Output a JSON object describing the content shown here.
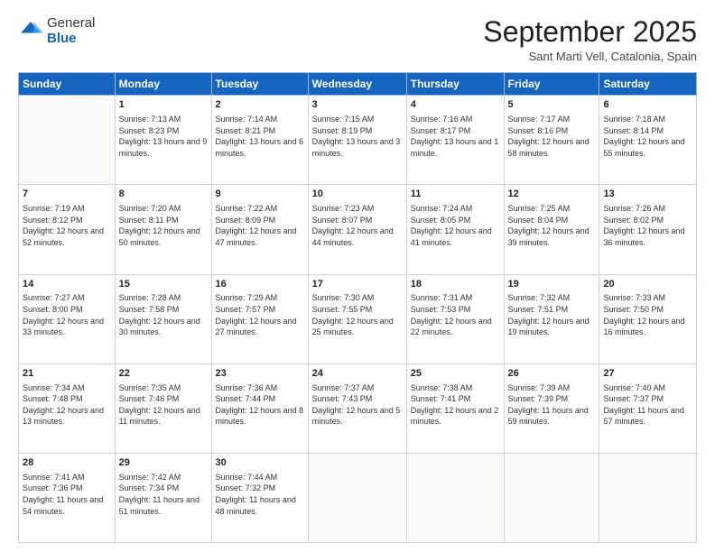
{
  "logo": {
    "general": "General",
    "blue": "Blue"
  },
  "header": {
    "title": "September 2025",
    "location": "Sant Marti Vell, Catalonia, Spain"
  },
  "weekdays": [
    "Sunday",
    "Monday",
    "Tuesday",
    "Wednesday",
    "Thursday",
    "Friday",
    "Saturday"
  ],
  "weeks": [
    [
      {
        "day": "",
        "sunrise": "",
        "sunset": "",
        "daylight": ""
      },
      {
        "day": "1",
        "sunrise": "Sunrise: 7:13 AM",
        "sunset": "Sunset: 8:23 PM",
        "daylight": "Daylight: 13 hours and 9 minutes."
      },
      {
        "day": "2",
        "sunrise": "Sunrise: 7:14 AM",
        "sunset": "Sunset: 8:21 PM",
        "daylight": "Daylight: 13 hours and 6 minutes."
      },
      {
        "day": "3",
        "sunrise": "Sunrise: 7:15 AM",
        "sunset": "Sunset: 8:19 PM",
        "daylight": "Daylight: 13 hours and 3 minutes."
      },
      {
        "day": "4",
        "sunrise": "Sunrise: 7:16 AM",
        "sunset": "Sunset: 8:17 PM",
        "daylight": "Daylight: 13 hours and 1 minute."
      },
      {
        "day": "5",
        "sunrise": "Sunrise: 7:17 AM",
        "sunset": "Sunset: 8:16 PM",
        "daylight": "Daylight: 12 hours and 58 minutes."
      },
      {
        "day": "6",
        "sunrise": "Sunrise: 7:18 AM",
        "sunset": "Sunset: 8:14 PM",
        "daylight": "Daylight: 12 hours and 55 minutes."
      }
    ],
    [
      {
        "day": "7",
        "sunrise": "Sunrise: 7:19 AM",
        "sunset": "Sunset: 8:12 PM",
        "daylight": "Daylight: 12 hours and 52 minutes."
      },
      {
        "day": "8",
        "sunrise": "Sunrise: 7:20 AM",
        "sunset": "Sunset: 8:11 PM",
        "daylight": "Daylight: 12 hours and 50 minutes."
      },
      {
        "day": "9",
        "sunrise": "Sunrise: 7:22 AM",
        "sunset": "Sunset: 8:09 PM",
        "daylight": "Daylight: 12 hours and 47 minutes."
      },
      {
        "day": "10",
        "sunrise": "Sunrise: 7:23 AM",
        "sunset": "Sunset: 8:07 PM",
        "daylight": "Daylight: 12 hours and 44 minutes."
      },
      {
        "day": "11",
        "sunrise": "Sunrise: 7:24 AM",
        "sunset": "Sunset: 8:05 PM",
        "daylight": "Daylight: 12 hours and 41 minutes."
      },
      {
        "day": "12",
        "sunrise": "Sunrise: 7:25 AM",
        "sunset": "Sunset: 8:04 PM",
        "daylight": "Daylight: 12 hours and 39 minutes."
      },
      {
        "day": "13",
        "sunrise": "Sunrise: 7:26 AM",
        "sunset": "Sunset: 8:02 PM",
        "daylight": "Daylight: 12 hours and 36 minutes."
      }
    ],
    [
      {
        "day": "14",
        "sunrise": "Sunrise: 7:27 AM",
        "sunset": "Sunset: 8:00 PM",
        "daylight": "Daylight: 12 hours and 33 minutes."
      },
      {
        "day": "15",
        "sunrise": "Sunrise: 7:28 AM",
        "sunset": "Sunset: 7:58 PM",
        "daylight": "Daylight: 12 hours and 30 minutes."
      },
      {
        "day": "16",
        "sunrise": "Sunrise: 7:29 AM",
        "sunset": "Sunset: 7:57 PM",
        "daylight": "Daylight: 12 hours and 27 minutes."
      },
      {
        "day": "17",
        "sunrise": "Sunrise: 7:30 AM",
        "sunset": "Sunset: 7:55 PM",
        "daylight": "Daylight: 12 hours and 25 minutes."
      },
      {
        "day": "18",
        "sunrise": "Sunrise: 7:31 AM",
        "sunset": "Sunset: 7:53 PM",
        "daylight": "Daylight: 12 hours and 22 minutes."
      },
      {
        "day": "19",
        "sunrise": "Sunrise: 7:32 AM",
        "sunset": "Sunset: 7:51 PM",
        "daylight": "Daylight: 12 hours and 19 minutes."
      },
      {
        "day": "20",
        "sunrise": "Sunrise: 7:33 AM",
        "sunset": "Sunset: 7:50 PM",
        "daylight": "Daylight: 12 hours and 16 minutes."
      }
    ],
    [
      {
        "day": "21",
        "sunrise": "Sunrise: 7:34 AM",
        "sunset": "Sunset: 7:48 PM",
        "daylight": "Daylight: 12 hours and 13 minutes."
      },
      {
        "day": "22",
        "sunrise": "Sunrise: 7:35 AM",
        "sunset": "Sunset: 7:46 PM",
        "daylight": "Daylight: 12 hours and 11 minutes."
      },
      {
        "day": "23",
        "sunrise": "Sunrise: 7:36 AM",
        "sunset": "Sunset: 7:44 PM",
        "daylight": "Daylight: 12 hours and 8 minutes."
      },
      {
        "day": "24",
        "sunrise": "Sunrise: 7:37 AM",
        "sunset": "Sunset: 7:43 PM",
        "daylight": "Daylight: 12 hours and 5 minutes."
      },
      {
        "day": "25",
        "sunrise": "Sunrise: 7:38 AM",
        "sunset": "Sunset: 7:41 PM",
        "daylight": "Daylight: 12 hours and 2 minutes."
      },
      {
        "day": "26",
        "sunrise": "Sunrise: 7:39 AM",
        "sunset": "Sunset: 7:39 PM",
        "daylight": "Daylight: 11 hours and 59 minutes."
      },
      {
        "day": "27",
        "sunrise": "Sunrise: 7:40 AM",
        "sunset": "Sunset: 7:37 PM",
        "daylight": "Daylight: 11 hours and 57 minutes."
      }
    ],
    [
      {
        "day": "28",
        "sunrise": "Sunrise: 7:41 AM",
        "sunset": "Sunset: 7:36 PM",
        "daylight": "Daylight: 11 hours and 54 minutes."
      },
      {
        "day": "29",
        "sunrise": "Sunrise: 7:42 AM",
        "sunset": "Sunset: 7:34 PM",
        "daylight": "Daylight: 11 hours and 51 minutes."
      },
      {
        "day": "30",
        "sunrise": "Sunrise: 7:44 AM",
        "sunset": "Sunset: 7:32 PM",
        "daylight": "Daylight: 11 hours and 48 minutes."
      },
      {
        "day": "",
        "sunrise": "",
        "sunset": "",
        "daylight": ""
      },
      {
        "day": "",
        "sunrise": "",
        "sunset": "",
        "daylight": ""
      },
      {
        "day": "",
        "sunrise": "",
        "sunset": "",
        "daylight": ""
      },
      {
        "day": "",
        "sunrise": "",
        "sunset": "",
        "daylight": ""
      }
    ]
  ]
}
